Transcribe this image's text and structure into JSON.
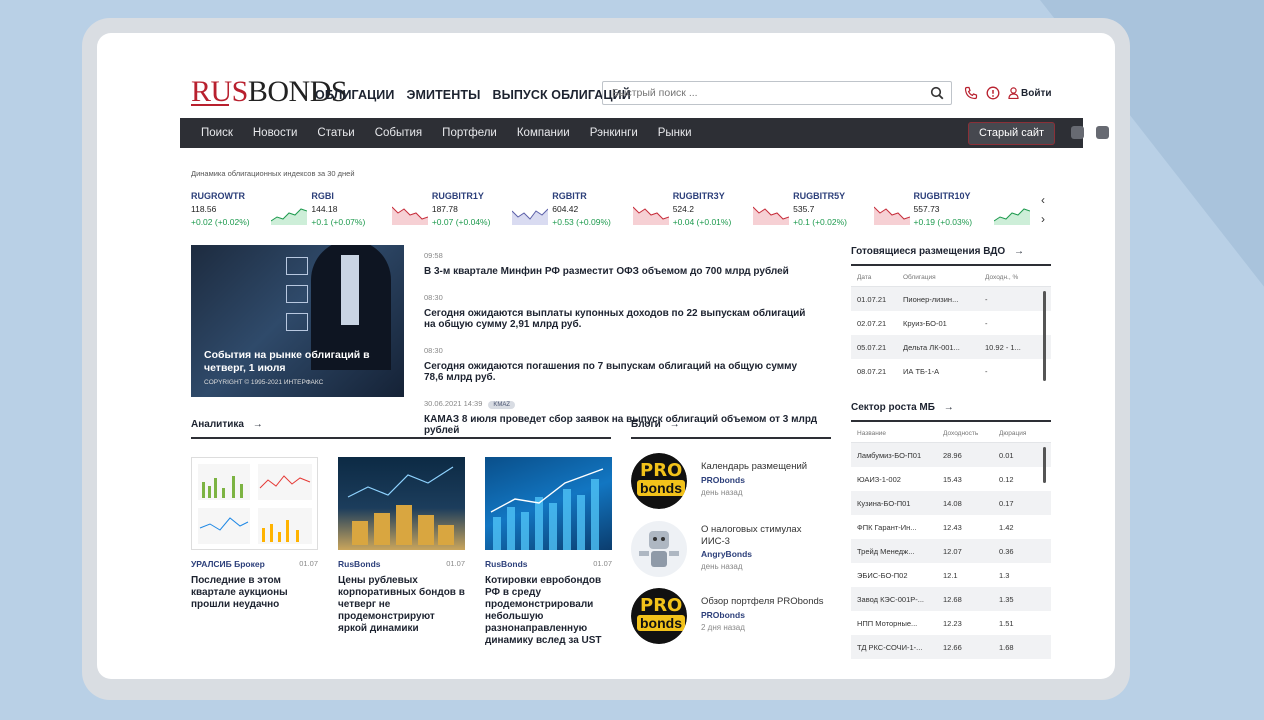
{
  "header": {
    "logo_rus": "RUS",
    "logo_bonds": "BONDS",
    "nav": [
      "ОБЛИГАЦИИ",
      "ЭМИТЕНТЫ",
      "ВЫПУСК ОБЛИГАЦИЙ"
    ],
    "search_placeholder": "Быстрый поиск ...",
    "login": "Войти"
  },
  "menu": {
    "items": [
      "Поиск",
      "Новости",
      "Статьи",
      "События",
      "Портфели",
      "Компании",
      "Рэнкинги",
      "Рынки"
    ],
    "old_site": "Старый сайт"
  },
  "tickers": {
    "caption": "Динамика облигационных индексов за 30 дней",
    "items": [
      {
        "name": "RUGROWTR",
        "value": "118.56",
        "change": "+0.02 (+0.02%)",
        "trend": "up"
      },
      {
        "name": "RGBI",
        "value": "144.18",
        "change": "+0.1 (+0.07%)",
        "trend": "down"
      },
      {
        "name": "RUGBITR1Y",
        "value": "187.78",
        "change": "+0.07 (+0.04%)",
        "trend": "mixed"
      },
      {
        "name": "RGBITR",
        "value": "604.42",
        "change": "+0.53 (+0.09%)",
        "trend": "down"
      },
      {
        "name": "RUGBITR3Y",
        "value": "524.2",
        "change": "+0.04 (+0.01%)",
        "trend": "down"
      },
      {
        "name": "RUGBITR5Y",
        "value": "535.7",
        "change": "+0.1 (+0.02%)",
        "trend": "down"
      },
      {
        "name": "RUGBITR10Y",
        "value": "557.73",
        "change": "+0.19 (+0.03%)",
        "trend": "up"
      }
    ]
  },
  "hero": {
    "title": "События на рынке облигаций в четверг, 1 июля",
    "copyright": "COPYRIGHT © 1995-2021 ИНТЕРФАКС"
  },
  "news": [
    {
      "time": "09:58",
      "badge": "",
      "headline": "В 3-м квартале Минфин РФ разместит ОФЗ объемом до 700 млрд рублей"
    },
    {
      "time": "08:30",
      "badge": "",
      "headline": "Сегодня ожидаются выплаты купонных доходов по 22 выпускам облигаций на общую сумму 2,91 млрд руб."
    },
    {
      "time": "08:30",
      "badge": "",
      "headline": "Сегодня ожидаются погашения по 7 выпускам облигаций на общую сумму 78,6 млрд руб."
    },
    {
      "time": "30.06.2021 14:39",
      "badge": "KMAZ",
      "headline": "КАМАЗ 8 июля проведет сбор заявок на выпуск облигаций объемом от 3 млрд рублей"
    }
  ],
  "analytics": {
    "title": "Аналитика",
    "arrow": "→",
    "cards": [
      {
        "source": "УРАЛСИБ Брокер",
        "date": "01.07",
        "title": "Последние в этом квартале аукционы прошли неудачно"
      },
      {
        "source": "RusBonds",
        "date": "01.07",
        "title": "Цены рублевых корпоративных бондов в четверг не продемонстрируют яркой динамики"
      },
      {
        "source": "RusBonds",
        "date": "01.07",
        "title": "Котировки евробондов РФ в среду продемонстрировали небольшую разнонаправленную динамику вслед за UST"
      }
    ]
  },
  "blogs": {
    "title": "Блоги",
    "arrow": "→",
    "items": [
      {
        "title": "Календарь размещений",
        "author": "PRObonds",
        "ago": "день назад",
        "avatar": "probonds"
      },
      {
        "title": "О налоговых стимулах ИИС-3",
        "author": "AngryBonds",
        "ago": "день назад",
        "avatar": "angrybonds"
      },
      {
        "title": "Обзор портфеля PRObonds",
        "author": "PRObonds",
        "ago": "2 дня назад",
        "avatar": "probonds"
      }
    ],
    "pro_text_1": "PRO",
    "pro_text_2": "bonds"
  },
  "vdo": {
    "title": "Готовящиеся размещения ВДО",
    "arrow": "→",
    "columns": [
      "Дата",
      "Облигация",
      "Доходн., %"
    ],
    "rows": [
      [
        "01.07.21",
        "Пионер-лизин...",
        "-"
      ],
      [
        "02.07.21",
        "Круиз-БО-01",
        "-"
      ],
      [
        "05.07.21",
        "Дельта ЛК-001...",
        "10.92 - 1..."
      ],
      [
        "08.07.21",
        "ИА ТБ-1-А",
        "-"
      ]
    ]
  },
  "mb": {
    "title": "Сектор роста МБ",
    "arrow": "→",
    "columns": [
      "Название",
      "Доходность",
      "Дюрация"
    ],
    "rows": [
      [
        "Ламбумиз-БО-П01",
        "28.96",
        "0.01"
      ],
      [
        "ЮАИЗ-1-002",
        "15.43",
        "0.12"
      ],
      [
        "Кузина-БО-П01",
        "14.08",
        "0.17"
      ],
      [
        "ФПК Гарант-Ин...",
        "12.43",
        "1.42"
      ],
      [
        "Трейд Менедж...",
        "12.07",
        "0.36"
      ],
      [
        "ЭБИС-БО-П02",
        "12.1",
        "1.3"
      ],
      [
        "Завод КЭС-001Р-...",
        "12.68",
        "1.35"
      ],
      [
        "НПП Моторные...",
        "12.23",
        "1.51"
      ],
      [
        "ТД РКС-СОЧИ-1-...",
        "12.66",
        "1.68"
      ]
    ]
  },
  "colors": {
    "brand": "#b8202e",
    "menu_bg": "#2d2f35",
    "up": "#1e9a4e",
    "link": "#2c3f7a"
  }
}
